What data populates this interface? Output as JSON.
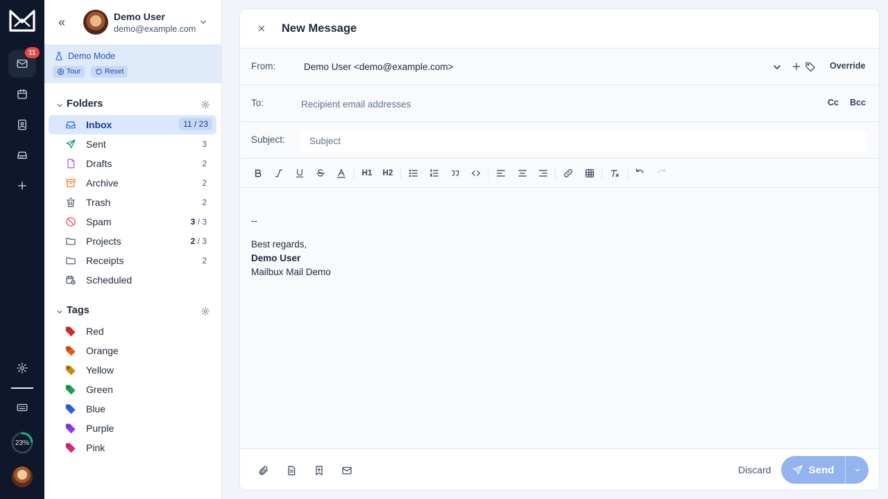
{
  "rail": {
    "mail_badge": "11",
    "progress_text": "23%",
    "progress_value": 0.23,
    "icons": [
      "app-logo-icon",
      "mail-icon",
      "calendar-icon",
      "contacts-icon",
      "inbox-tray-icon",
      "plus-icon",
      "settings-icon",
      "keyboard-icon"
    ]
  },
  "account": {
    "name": "Demo User",
    "email": "demo@example.com"
  },
  "demo": {
    "title": "Demo Mode",
    "tour_label": "Tour",
    "reset_label": "Reset"
  },
  "folders": {
    "title": "Folders",
    "items": [
      {
        "label": "Inbox",
        "count": "11 / 23",
        "icon": "inbox-icon",
        "color": "#2563eb",
        "active": true
      },
      {
        "label": "Sent",
        "count": "3",
        "icon": "send-icon",
        "color": "#059669"
      },
      {
        "label": "Drafts",
        "count": "2",
        "icon": "file-icon",
        "color": "#a855f7"
      },
      {
        "label": "Archive",
        "count": "2",
        "icon": "archive-icon",
        "color": "#f97316"
      },
      {
        "label": "Trash",
        "count": "2",
        "icon": "trash-icon",
        "color": "#475569"
      },
      {
        "label": "Spam",
        "count_bold": "3",
        "count_rest": " / 3",
        "icon": "ban-icon",
        "color": "#ef4444"
      },
      {
        "label": "Projects",
        "count_bold": "2",
        "count_rest": " / 3",
        "icon": "folder-icon",
        "color": "#475569"
      },
      {
        "label": "Receipts",
        "count": "2",
        "icon": "folder-icon",
        "color": "#475569"
      },
      {
        "label": "Scheduled",
        "count": "",
        "icon": "calendar-clock-icon",
        "color": "#475569"
      }
    ]
  },
  "tags": {
    "title": "Tags",
    "items": [
      {
        "label": "Red",
        "color": "#dc2626"
      },
      {
        "label": "Orange",
        "color": "#ea580c"
      },
      {
        "label": "Yellow",
        "color": "#ca8a04"
      },
      {
        "label": "Green",
        "color": "#16a34a"
      },
      {
        "label": "Blue",
        "color": "#2563eb"
      },
      {
        "label": "Purple",
        "color": "#9333ea"
      },
      {
        "label": "Pink",
        "color": "#db2777"
      }
    ]
  },
  "composer": {
    "title": "New Message",
    "from_label": "From:",
    "from_value": "Demo User <demo@example.com>",
    "override_label": "Override",
    "to_label": "To:",
    "to_placeholder": "Recipient email addresses",
    "cc_label": "Cc",
    "bcc_label": "Bcc",
    "subject_label": "Subject:",
    "subject_placeholder": "Subject",
    "signature": {
      "separator": "--",
      "greeting": "Best regards,",
      "name": "Demo User",
      "org": "Mailbux Mail Demo"
    },
    "toolbar": {
      "h1": "H1",
      "h2": "H2"
    },
    "discard_label": "Discard",
    "send_label": "Send"
  }
}
